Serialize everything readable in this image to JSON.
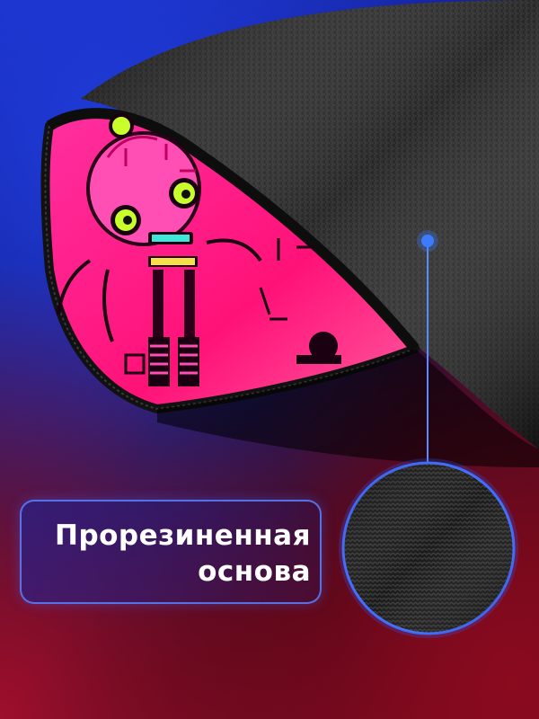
{
  "caption": {
    "line_1": "Прорезиненная",
    "line_2": "основа"
  },
  "colors": {
    "mat_black": "#1c1c1c",
    "print_pink": "#ff1d8c",
    "accent_blue": "#2f6bff",
    "eye_green": "#c8ff2a"
  }
}
